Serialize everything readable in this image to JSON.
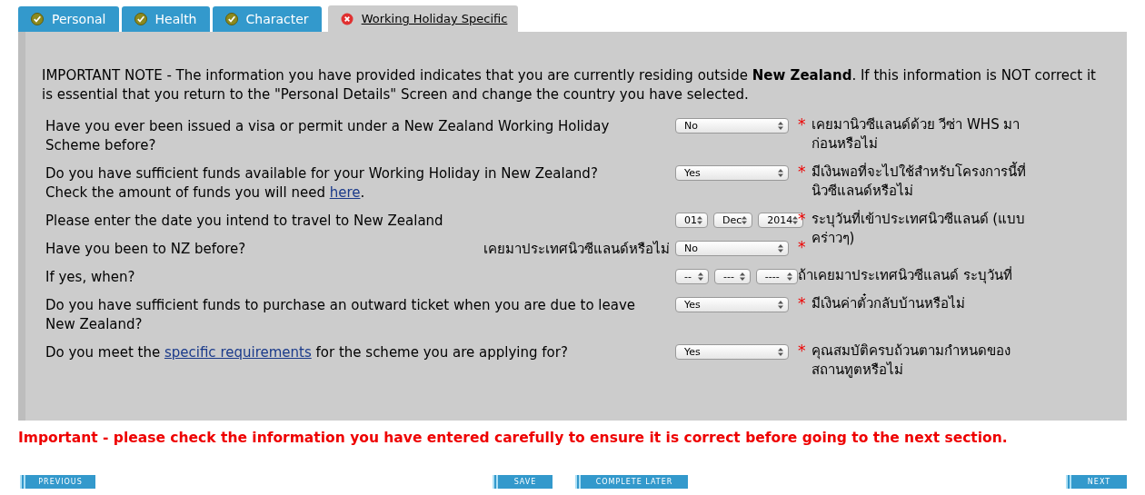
{
  "tabs": [
    {
      "label": "Personal",
      "complete": true,
      "selected": false
    },
    {
      "label": "Health",
      "complete": true,
      "selected": false
    },
    {
      "label": "Character",
      "complete": true,
      "selected": false
    },
    {
      "label": "Working Holiday Specific",
      "complete": false,
      "selected": true
    }
  ],
  "important_note": "IMPORTANT NOTE - The information you have provided indicates that you are currently residing outside **New Zealand**. If this information is NOT correct it is essential that you return to the \"Personal Details\" Screen and change the country you have selected.",
  "questions": [
    {
      "parts": [
        {
          "text": "Have you ever been issued a visa or permit under a New Zealand Working Holiday Scheme before?"
        }
      ],
      "selects": [
        "No"
      ],
      "required_mark": "*",
      "note": "เคยมานิวซีแลนด์ด้วย วีซ่า WHS มาก่อนหรือไม่"
    },
    {
      "parts": [
        {
          "text": "Do you have sufficient funds available for your Working Holiday in New Zealand? Check the amount of funds you will need "
        },
        {
          "link": "here"
        },
        {
          "text": "."
        }
      ],
      "selects": [
        "Yes"
      ],
      "required_mark": "*",
      "note": "มีเงินพอที่จะไปใช้สำหรับโครงการนี้ที่นิวซีแลนด์หรือไม่"
    },
    {
      "parts": [
        {
          "text": "Please enter the date you intend to travel to New Zealand"
        }
      ],
      "selects": [
        "01",
        "Dec",
        "2014"
      ],
      "required_mark": "*",
      "note": "ระบุวันที่เข้าประเทศนิวซีแลนด์ (แบบคร่าวๆ)"
    },
    {
      "parts": [
        {
          "text": "Have you been to NZ before?"
        }
      ],
      "inline_note": "เคยมาประเทศนิวซีแลนด์หรือไม่",
      "selects": [
        "No"
      ],
      "required_mark": "*"
    },
    {
      "parts": [
        {
          "text": "If yes, when?"
        }
      ],
      "selects": [
        "--",
        "---",
        "----"
      ],
      "note": "ถ้าเคยมาประเทศนิวซีแลนด์ ระบุวันที่"
    },
    {
      "parts": [
        {
          "text": "Do you have sufficient funds to purchase an outward ticket when you are due to leave New Zealand?"
        }
      ],
      "selects": [
        "Yes"
      ],
      "required_mark": "*",
      "note": "มีเงินค่าตั๋วกลับบ้านหรือไม่"
    },
    {
      "parts": [
        {
          "text": "Do you meet the "
        },
        {
          "link": "specific requirements"
        },
        {
          "text": " for the scheme you are applying for?"
        }
      ],
      "selects": [
        "Yes"
      ],
      "required_mark": "*",
      "note": "คุณสมบัติครบถ้วนตามกำหนดของสถานทูตหรือไม่"
    }
  ],
  "warning": "Important - please check the information you have entered carefully to ensure it is correct before going to the next section.",
  "buttons": {
    "previous": "PREVIOUS",
    "save": "SAVE",
    "complete_later": "COMPLETE LATER",
    "next": "NEXT"
  }
}
